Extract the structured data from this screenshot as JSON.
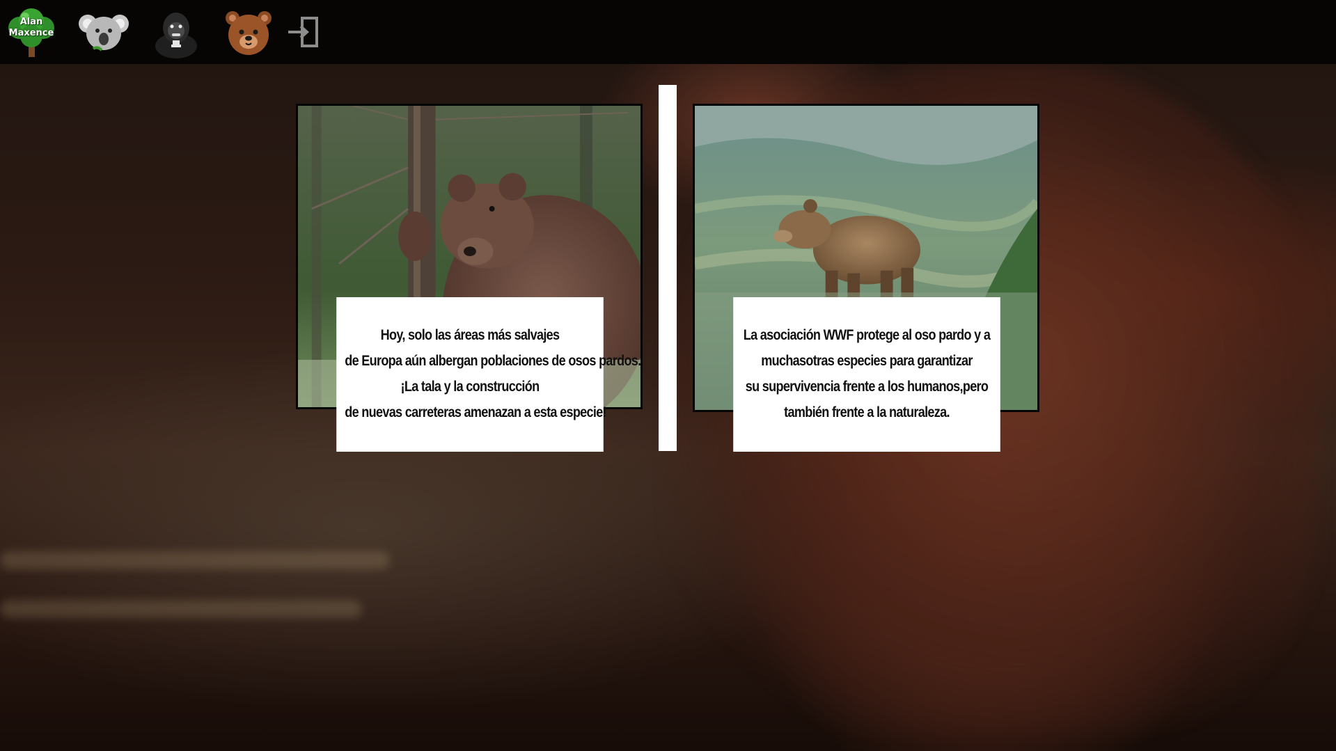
{
  "nav": {
    "logo_line1": "Alan",
    "logo_line2": "Maxence",
    "icons": [
      "koala-icon",
      "gorilla-icon",
      "bear-icon",
      "exit-icon"
    ]
  },
  "colors": {
    "topbar": "#060504",
    "card_text_bg": "#ffffff",
    "text": "#111111"
  },
  "cards": [
    {
      "lines": [
        "Hoy, solo las áreas más salvajes",
        "de Europa aún albergan poblaciones de osos pardos.",
        "¡La tala y la construcción",
        "de nuevas carreteras amenazan a esta especie!"
      ]
    },
    {
      "lines": [
        "La asociación WWF protege al oso pardo y a",
        "muchasotras especies para garantizar",
        "su supervivencia frente a los humanos,pero",
        "también frente a la naturaleza."
      ]
    }
  ]
}
